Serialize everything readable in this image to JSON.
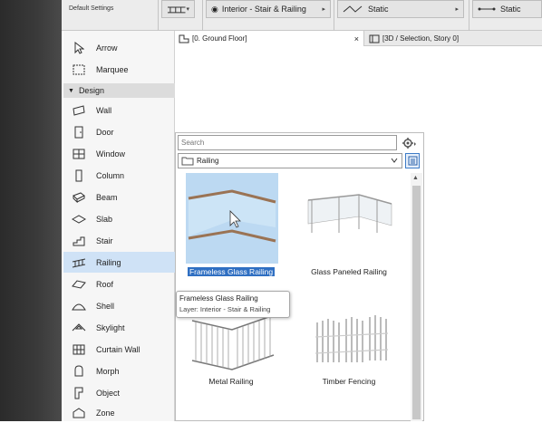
{
  "toolbar": {
    "settings_label": "Default Settings",
    "layer_label": "Interior - Stair & Railing",
    "static1": "Static",
    "static2": "Static"
  },
  "sidebar": {
    "top_items": [
      {
        "label": "Arrow",
        "icon": "arrow-icon"
      },
      {
        "label": "Marquee",
        "icon": "marquee-icon"
      }
    ],
    "group": "Design",
    "items": [
      {
        "label": "Wall",
        "icon": "wall-icon"
      },
      {
        "label": "Door",
        "icon": "door-icon"
      },
      {
        "label": "Window",
        "icon": "window-icon"
      },
      {
        "label": "Column",
        "icon": "column-icon"
      },
      {
        "label": "Beam",
        "icon": "beam-icon"
      },
      {
        "label": "Slab",
        "icon": "slab-icon"
      },
      {
        "label": "Stair",
        "icon": "stair-icon"
      },
      {
        "label": "Railing",
        "icon": "railing-icon",
        "selected": true
      },
      {
        "label": "Roof",
        "icon": "roof-icon"
      },
      {
        "label": "Shell",
        "icon": "shell-icon"
      },
      {
        "label": "Skylight",
        "icon": "skylight-icon"
      },
      {
        "label": "Curtain Wall",
        "icon": "curtain-wall-icon"
      },
      {
        "label": "Morph",
        "icon": "morph-icon"
      },
      {
        "label": "Object",
        "icon": "object-icon"
      },
      {
        "label": "Zone",
        "icon": "zone-icon"
      }
    ]
  },
  "tabs": [
    {
      "label": "[0. Ground Floor]",
      "close": "×"
    },
    {
      "label": "[3D / Selection, Story 0]"
    }
  ],
  "panel": {
    "search_placeholder": "Search",
    "folder": "Railing",
    "items": [
      {
        "label": "Frameless Glass Railing",
        "selected": true
      },
      {
        "label": "Glass Paneled Railing"
      },
      {
        "label": "Metal Railing"
      },
      {
        "label": "Timber Fencing"
      }
    ],
    "tooltip": {
      "title": "Frameless Glass Railing",
      "layer": "Layer: Interior - Stair & Railing"
    }
  },
  "colors": {
    "selection": "#cfe2f6",
    "accent": "#2f6fc2"
  }
}
